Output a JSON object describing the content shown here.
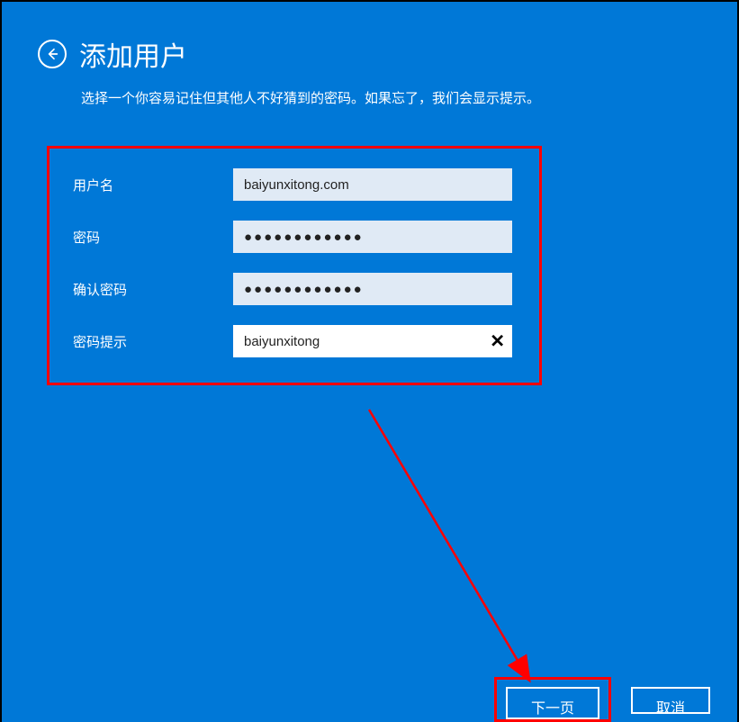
{
  "header": {
    "title": "添加用户",
    "subtitle": "选择一个你容易记住但其他人不好猜到的密码。如果忘了，我们会显示提示。"
  },
  "form": {
    "username_label": "用户名",
    "username_value": "baiyunxitong.com",
    "password_label": "密码",
    "password_value": "●●●●●●●●●●●●",
    "confirm_label": "确认密码",
    "confirm_value": "●●●●●●●●●●●●",
    "hint_label": "密码提示",
    "hint_value": "baiyunxitong"
  },
  "buttons": {
    "next": "下一页",
    "cancel": "取消"
  }
}
